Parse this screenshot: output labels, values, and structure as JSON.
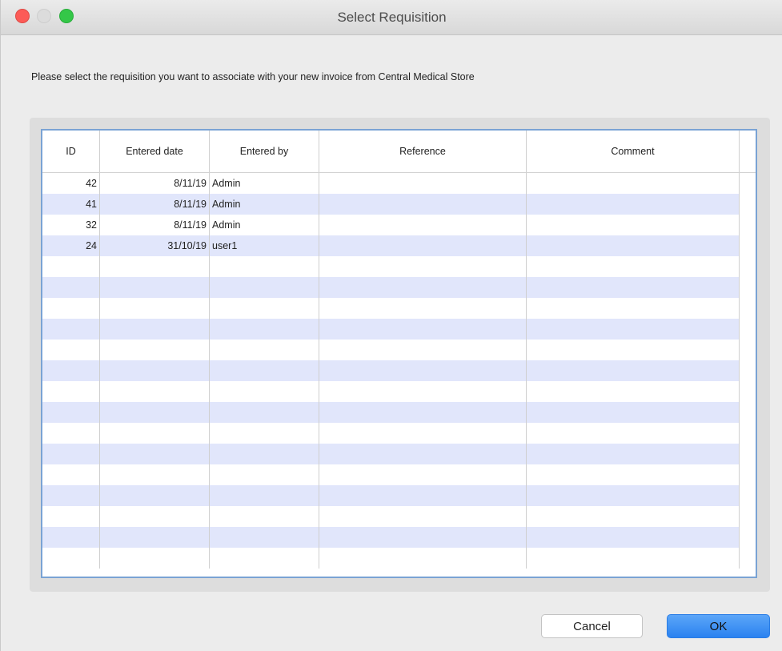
{
  "window": {
    "title": "Select Requisition"
  },
  "prompt": "Please select the requisition you want to associate with your new invoice from Central Medical Store",
  "table": {
    "columns": [
      "ID",
      "Entered date",
      "Entered by",
      "Reference",
      "Comment"
    ],
    "rows": [
      {
        "id": "42",
        "entered_date": "8/11/19",
        "entered_by": "Admin",
        "reference": "",
        "comment": ""
      },
      {
        "id": "41",
        "entered_date": "8/11/19",
        "entered_by": "Admin",
        "reference": "",
        "comment": ""
      },
      {
        "id": "32",
        "entered_date": "8/11/19",
        "entered_by": "Admin",
        "reference": "",
        "comment": ""
      },
      {
        "id": "24",
        "entered_date": "31/10/19",
        "entered_by": "user1",
        "reference": "",
        "comment": ""
      }
    ],
    "empty_row_count": 15,
    "stripe_color": "#e1e6fb"
  },
  "buttons": {
    "cancel": "Cancel",
    "ok": "OK"
  },
  "colors": {
    "close": "#fc5b57",
    "minimize": "#dcdcdc",
    "maximize": "#34c748",
    "ok_button": "#2a82f0",
    "table_border": "#7aa3d4"
  }
}
